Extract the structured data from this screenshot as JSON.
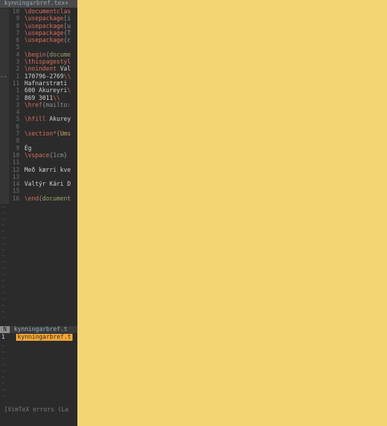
{
  "tabline": {
    "title": "kynningarbref.tex+"
  },
  "editor": {
    "lines": [
      {
        "num": "10",
        "marker": "",
        "parts": [
          {
            "t": "\\documentclas",
            "c": "cmd"
          }
        ]
      },
      {
        "num": "9",
        "marker": "",
        "parts": [
          {
            "t": "\\usepackage",
            "c": "cmd"
          },
          {
            "t": "[i",
            "c": "brace"
          }
        ]
      },
      {
        "num": "8",
        "marker": "",
        "parts": [
          {
            "t": "\\usepackage",
            "c": "cmd"
          },
          {
            "t": "[u",
            "c": "brace"
          }
        ]
      },
      {
        "num": "7",
        "marker": "",
        "parts": [
          {
            "t": "\\usepackage",
            "c": "cmd"
          },
          {
            "t": "{T",
            "c": "brace"
          }
        ]
      },
      {
        "num": "6",
        "marker": "",
        "parts": [
          {
            "t": "\\usepackage",
            "c": "cmd"
          },
          {
            "t": "{c",
            "c": "brace"
          }
        ]
      },
      {
        "num": "5",
        "marker": "",
        "parts": []
      },
      {
        "num": "4",
        "marker": "",
        "parts": [
          {
            "t": "\\begin",
            "c": "cmd"
          },
          {
            "t": "{",
            "c": "brace"
          },
          {
            "t": "docume",
            "c": "arg"
          }
        ]
      },
      {
        "num": "3",
        "marker": "",
        "parts": [
          {
            "t": "\\thispagestyl",
            "c": "cmd"
          }
        ]
      },
      {
        "num": "2",
        "marker": "",
        "parts": [
          {
            "t": "\\noindent",
            "c": "cmd"
          },
          {
            "t": " Val",
            "c": ""
          }
        ]
      },
      {
        "num": "1",
        "marker": "--",
        "parts": [
          {
            "t": "170796-2769",
            "c": ""
          },
          {
            "t": "\\\\",
            "c": "cmd"
          }
        ]
      },
      {
        "num": "11",
        "marker": "",
        "parts": [
          {
            "t": "Hafnarstræti",
            "c": ""
          }
        ]
      },
      {
        "num": "1",
        "marker": "",
        "parts": [
          {
            "t": "600 Akureyri",
            "c": ""
          },
          {
            "t": "\\",
            "c": "cmd"
          }
        ]
      },
      {
        "num": "2",
        "marker": "",
        "parts": [
          {
            "t": "869 3011",
            "c": ""
          },
          {
            "t": "\\\\",
            "c": "cmd"
          }
        ]
      },
      {
        "num": "3",
        "marker": "",
        "parts": [
          {
            "t": "\\href",
            "c": "cmd"
          },
          {
            "t": "{mailto:",
            "c": "brace"
          }
        ]
      },
      {
        "num": "4",
        "marker": "",
        "parts": []
      },
      {
        "num": "5",
        "marker": "",
        "parts": [
          {
            "t": "\\hfill",
            "c": "cmd"
          },
          {
            "t": " Akurey",
            "c": ""
          }
        ]
      },
      {
        "num": "6",
        "marker": "",
        "parts": []
      },
      {
        "num": "7",
        "marker": "",
        "parts": [
          {
            "t": "\\section*",
            "c": "cmd"
          },
          {
            "t": "{",
            "c": "brace"
          },
          {
            "t": "Ums",
            "c": "sec"
          }
        ]
      },
      {
        "num": "8",
        "marker": "",
        "parts": []
      },
      {
        "num": "9",
        "marker": "",
        "parts": [
          {
            "t": "Ég",
            "c": ""
          }
        ]
      },
      {
        "num": "10",
        "marker": "",
        "parts": [
          {
            "t": "\\vspace",
            "c": "cmd"
          },
          {
            "t": "{1cm}",
            "c": "brace"
          }
        ]
      },
      {
        "num": "11",
        "marker": "",
        "parts": []
      },
      {
        "num": "12",
        "marker": "",
        "parts": [
          {
            "t": "Með kærri kve",
            "c": ""
          }
        ]
      },
      {
        "num": "13",
        "marker": "",
        "parts": []
      },
      {
        "num": "14",
        "marker": "",
        "parts": [
          {
            "t": "Valtýr Kári D",
            "c": ""
          }
        ]
      },
      {
        "num": "15",
        "marker": "",
        "parts": []
      },
      {
        "num": "16",
        "marker": "",
        "parts": [
          {
            "t": "\\end",
            "c": "cmd"
          },
          {
            "t": "{",
            "c": "brace"
          },
          {
            "t": "document",
            "c": "arg"
          }
        ]
      }
    ]
  },
  "tilde_char": "~",
  "quickfix": {
    "mode": "N",
    "name": "kynningarbref.t",
    "line_num": "1",
    "entry": "kynningarbref.t"
  },
  "cmdline": "[VimTeX errors (La",
  "colors": {
    "right_pane": "#f3d576",
    "quickfix_highlight": "#f4a533"
  }
}
